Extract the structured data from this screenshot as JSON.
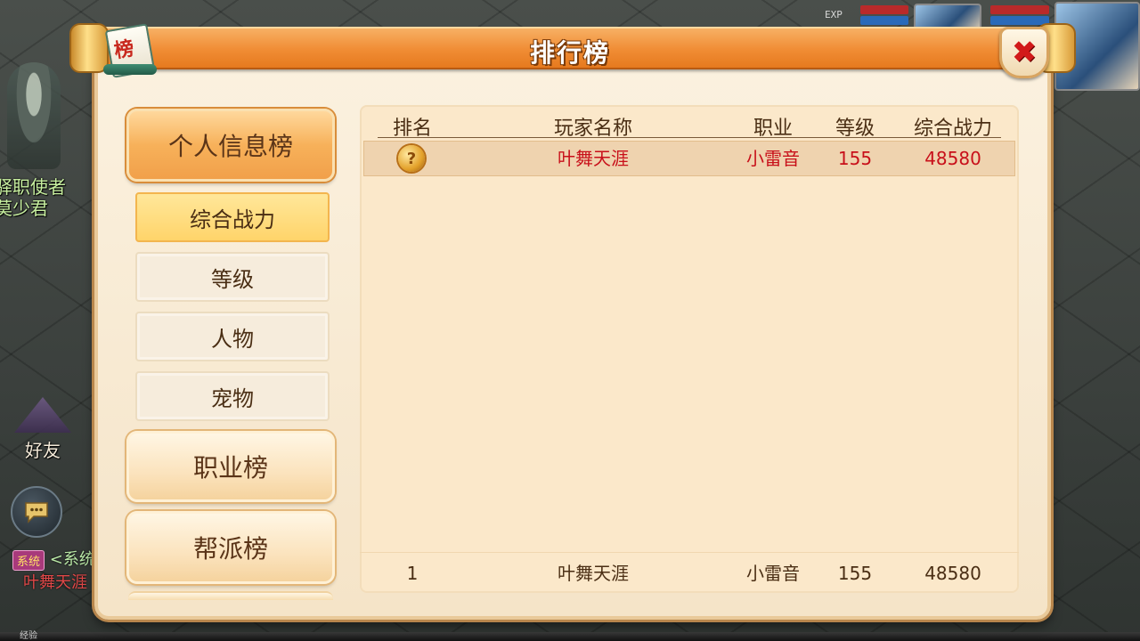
{
  "background": {
    "npc_name_lines": [
      "驿职使者",
      "莫少君"
    ],
    "friend_label": "好友",
    "hud_exp_label": "EXP",
    "chat": {
      "badge": "系统",
      "message_start": "<系统",
      "message_second_line": "叶舞天涯"
    },
    "bottom_label": "经验"
  },
  "panel": {
    "title": "排行榜",
    "badge_char": "榜",
    "close_icon": "close-icon"
  },
  "menu": {
    "categories": [
      {
        "label": "个人信息榜",
        "active": true
      },
      {
        "label": "职业榜",
        "active": false
      },
      {
        "label": "帮派榜",
        "active": false
      }
    ],
    "subitems": [
      {
        "label": "综合战力",
        "active": true
      },
      {
        "label": "等级",
        "active": false
      },
      {
        "label": "人物",
        "active": false
      },
      {
        "label": "宠物",
        "active": false
      }
    ]
  },
  "table": {
    "headers": [
      "排名",
      "玩家名称",
      "职业",
      "等级",
      "综合战力"
    ],
    "rows": [
      {
        "rank_icon": "gold-medal-icon",
        "name": "叶舞天涯",
        "job": "小雷音",
        "level": "155",
        "power": "48580"
      }
    ],
    "my_rank": {
      "rank": "1",
      "name": "叶舞天涯",
      "job": "小雷音",
      "level": "155",
      "power": "48580"
    }
  },
  "colors": {
    "header_orange": "#f08c34",
    "panel_bg": "#fbf1df",
    "highlight_text": "#c8101a",
    "close_red": "#d21a1a"
  }
}
